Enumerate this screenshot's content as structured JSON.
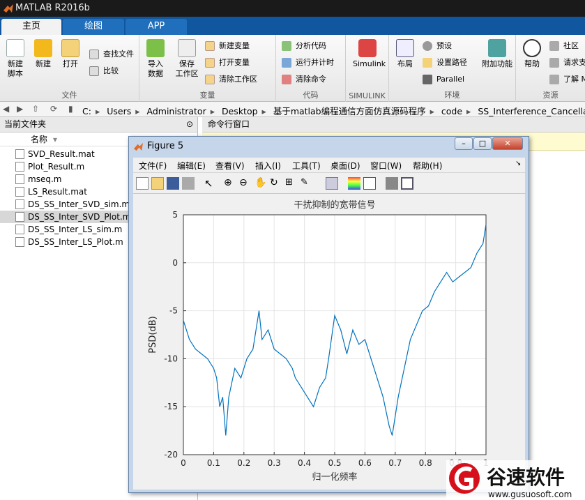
{
  "app": {
    "title": "MATLAB R2016b"
  },
  "tabs": [
    {
      "label": "主页"
    },
    {
      "label": "绘图"
    },
    {
      "label": "APP"
    }
  ],
  "ribbon": {
    "file": {
      "label": "文件",
      "new_script": "新建\n脚本",
      "new": "新建",
      "open": "打开",
      "find_files": "查找文件",
      "compare": "比较"
    },
    "variable": {
      "label": "变量",
      "import": "导入\n数据",
      "save_ws": "保存\n工作区",
      "new_var": "新建变量",
      "open_var": "打开变量",
      "clear_ws": "清除工作区"
    },
    "code": {
      "label": "代码",
      "analyze": "分析代码",
      "run_time": "运行并计时",
      "clear_cmd": "清除命令"
    },
    "simulink": {
      "label": "SIMULINK",
      "simulink": "Simulink"
    },
    "env": {
      "label": "环境",
      "layout": "布局",
      "prefs": "预设",
      "set_path": "设置路径",
      "parallel": "Parallel",
      "addons": "附加功能"
    },
    "resources": {
      "label": "资源",
      "help": "帮助",
      "community": "社区",
      "request": "请求支",
      "learn": "了解 M"
    }
  },
  "address": {
    "crumbs": [
      "C:",
      "Users",
      "Administrator",
      "Desktop",
      "基于matlab编程通信方面仿真源码程序",
      "code",
      "SS_Interference_Cancellation"
    ]
  },
  "left_panel": {
    "title": "当前文件夹",
    "col_name": "名称",
    "files": [
      "SVD_Result.mat",
      "Plot_Result.m",
      "mseq.m",
      "LS_Result.mat",
      "DS_SS_Inter_SVD_sim.m",
      "DS_SS_Inter_SVD_Plot.m",
      "DS_SS_Inter_LS_sim.m",
      "DS_SS_Inter_LS_Plot.m"
    ],
    "selected_index": 5
  },
  "right_panel": {
    "title": "命令行窗口"
  },
  "figure": {
    "title": "Figure 5",
    "menus": [
      "文件(F)",
      "编辑(E)",
      "查看(V)",
      "插入(I)",
      "工具(T)",
      "桌面(D)",
      "窗口(W)",
      "帮助(H)"
    ]
  },
  "chart_data": {
    "type": "line",
    "title": "干扰抑制的宽带信号",
    "xlabel": "归一化频率",
    "ylabel": "PSD(dB)",
    "xlim": [
      0,
      1
    ],
    "ylim": [
      -20,
      5
    ],
    "xticks": [
      "0",
      "0.1",
      "0.2",
      "0.3",
      "0.4",
      "0.5",
      "0.6",
      "0.7",
      "0.8",
      "0.9",
      "1"
    ],
    "yticks": [
      "5",
      "0",
      "-5",
      "-10",
      "-15",
      "-20"
    ],
    "grid": true,
    "color": "#0072bd",
    "x": [
      0,
      0.02,
      0.04,
      0.06,
      0.08,
      0.1,
      0.11,
      0.12,
      0.13,
      0.14,
      0.15,
      0.17,
      0.19,
      0.21,
      0.23,
      0.25,
      0.26,
      0.28,
      0.3,
      0.32,
      0.34,
      0.36,
      0.37,
      0.39,
      0.41,
      0.43,
      0.45,
      0.47,
      0.48,
      0.5,
      0.52,
      0.54,
      0.56,
      0.58,
      0.6,
      0.62,
      0.64,
      0.66,
      0.68,
      0.69,
      0.7,
      0.71,
      0.73,
      0.75,
      0.77,
      0.79,
      0.81,
      0.83,
      0.85,
      0.87,
      0.89,
      0.91,
      0.93,
      0.95,
      0.97,
      0.99,
      1.0
    ],
    "y": [
      -6,
      -8,
      -9,
      -9.5,
      -10,
      -11,
      -12,
      -15,
      -14,
      -18,
      -14,
      -11,
      -12,
      -10,
      -9,
      -5,
      -8,
      -7,
      -9,
      -9.5,
      -10,
      -11,
      -12,
      -13,
      -14,
      -15,
      -13,
      -12,
      -10,
      -5.5,
      -7,
      -9.5,
      -7,
      -8.5,
      -8,
      -10,
      -12,
      -14,
      -17,
      -18,
      -16,
      -14,
      -11,
      -8,
      -6.5,
      -5,
      -4.5,
      -3,
      -2,
      -1,
      -2,
      -1.5,
      -1,
      -0.5,
      1,
      2,
      4
    ]
  }
}
